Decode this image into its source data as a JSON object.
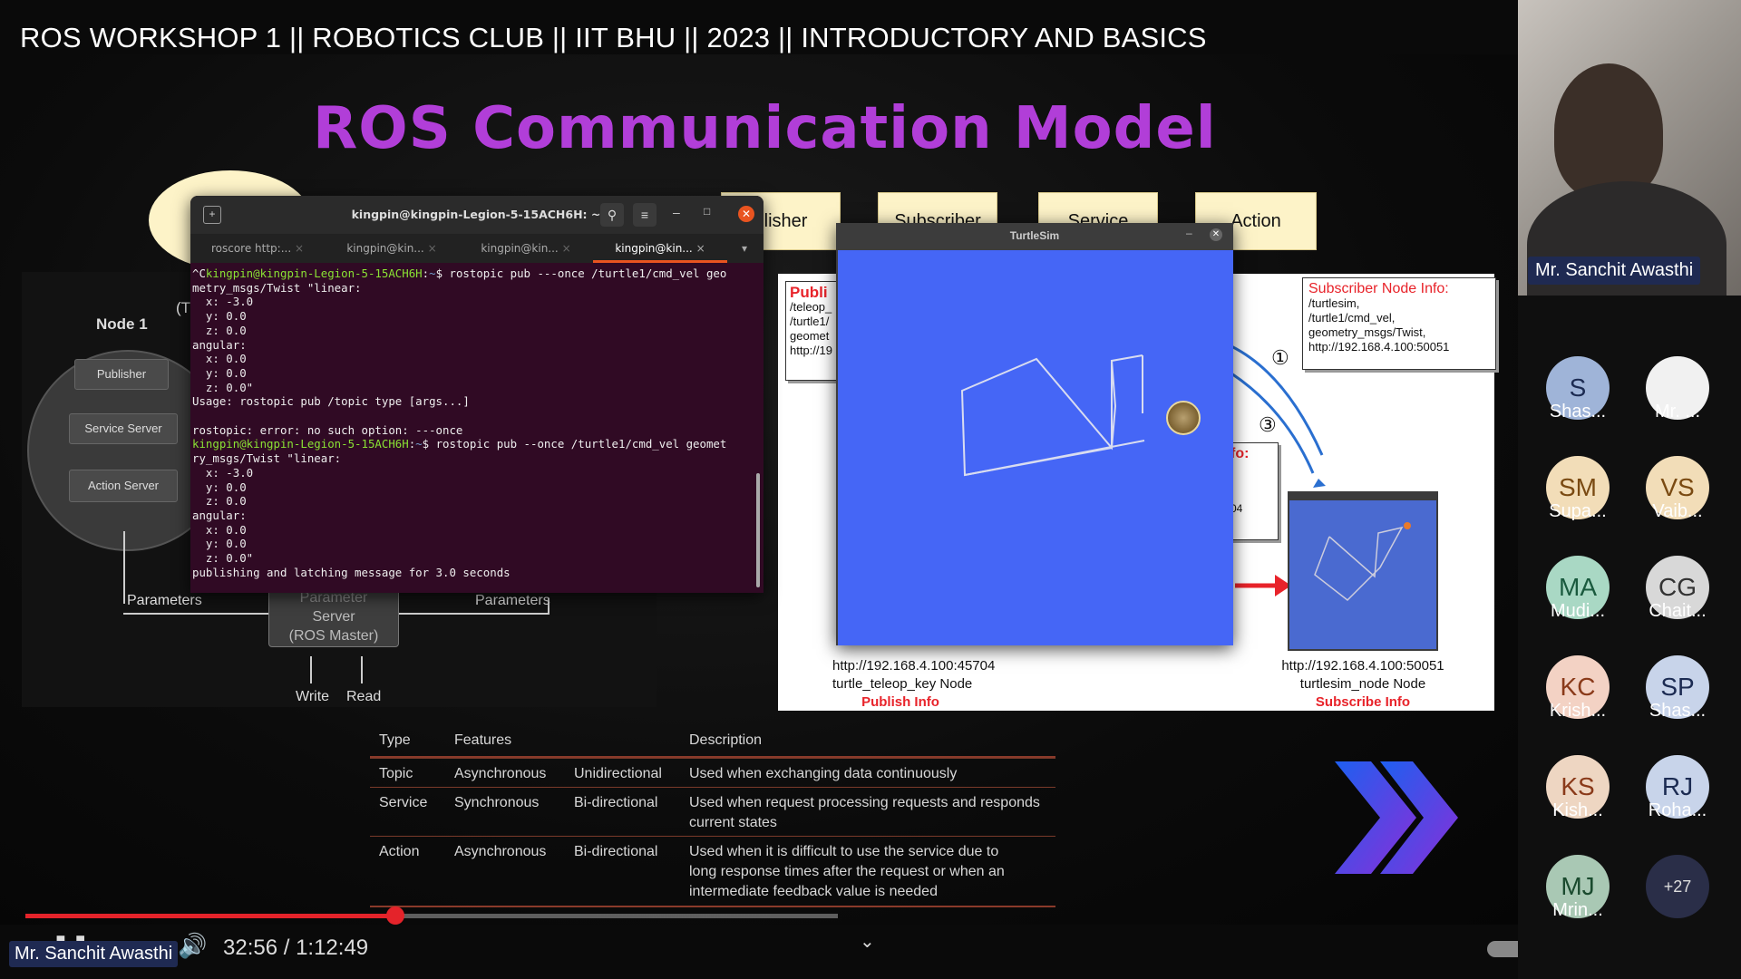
{
  "video": {
    "title": "ROS WORKSHOP 1 || ROBOTICS CLUB || IIT BHU || 2023 || INTRODUCTORY AND BASICS"
  },
  "slide": {
    "title": "ROS Communication Model",
    "top_boxes": [
      "blisher",
      "Subscriber",
      "Service",
      "Action"
    ],
    "node_diagram": {
      "node_label": "Node 1",
      "partial_label": "(T",
      "buttons": [
        "Publisher",
        "Service Server",
        "Action Server"
      ],
      "params_left": "Parameters",
      "params_right": "Parameters",
      "master_line1": "Parameter",
      "master_line2": "Server",
      "master_line3": "(ROS Master)",
      "write": "Write",
      "read": "Read"
    },
    "table": {
      "headers": [
        "Type",
        "Features",
        "",
        "Description"
      ],
      "rows": [
        {
          "type": "Topic",
          "sync": "Asynchronous",
          "dir": "Unidirectional",
          "desc": "Used when exchanging data continuously"
        },
        {
          "type": "Service",
          "sync": "Synchronous",
          "dir": "Bi-directional",
          "desc": "Used when request processing requests and responds current states"
        },
        {
          "type": "Action",
          "sync": "Asynchronous",
          "dir": "Bi-directional",
          "desc": "Used when it is difficult to use the service due to long response times after the request or when an intermediate feedback value is needed"
        }
      ]
    }
  },
  "terminal": {
    "title": "kingpin@kingpin-Legion-5-15ACH6H: ~",
    "tabs": [
      "roscore http:...",
      "kingpin@kin...",
      "kingpin@kin...",
      "kingpin@kin..."
    ],
    "prompt": "kingpin@kingpin-Legion-5-15ACH6H",
    "cmd1": "rostopic pub ---once /turtle1/cmd_vel geo",
    "cmd1_cont": "metry_msgs/Twist \"linear:",
    "out1": "  x: -3.0\n  y: 0.0\n  z: 0.0\nangular:\n  x: 0.0\n  y: 0.0\n  z: 0.0\"\nUsage: rostopic pub /topic type [args...]\n\nrostopic: error: no such option: ---once",
    "cmd2": "rostopic pub --once /turtle1/cmd_vel geomet",
    "cmd2_cont": "ry_msgs/Twist \"linear:",
    "out2": "  x: -3.0\n  y: 0.0\n  z: 0.0\nangular:\n  x: 0.0\n  y: 0.0\n  z: 0.0\"\npublishing and latching message for 3.0 seconds"
  },
  "turtlesim": {
    "title": "TurtleSim"
  },
  "diagram": {
    "publisher_partial": "Publi",
    "publisher_lines": [
      "/teleop_",
      "/turtle1/",
      "geomet",
      "http://19"
    ],
    "subscriber_title": "Subscriber Node Info:",
    "subscriber_lines": [
      "/turtlesim,",
      "/turtle1/cmd_vel,",
      "geometry_msgs/Twist,",
      "http://192.168.4.100:50051"
    ],
    "info_partial": "fo:",
    "num_partial": "04",
    "step1": "①",
    "step3": "③",
    "left_url": "http://192.168.4.100:45704",
    "left_node": "turtle_teleop_key Node",
    "left_info": "Publish Info",
    "right_url": "http://192.168.4.100:50051",
    "right_node": "turtlesim_node Node",
    "right_info": "Subscribe Info"
  },
  "participants": {
    "speaker_name": "Mr. Sanchit Awasthi",
    "list": [
      {
        "initials": "S",
        "name": "Shas...",
        "color": "#9fb4d8",
        "text": "#1c2b52"
      },
      {
        "initials": "",
        "name": "Mr. ...",
        "color": "#f1f1f1",
        "text": "#222"
      },
      {
        "initials": "SM",
        "name": "Supa...",
        "color": "#f2ddb8",
        "text": "#7a4a12"
      },
      {
        "initials": "VS",
        "name": "Vaib...",
        "color": "#f2ddb8",
        "text": "#7a4a12"
      },
      {
        "initials": "MA",
        "name": "Mudi...",
        "color": "#a9d8c4",
        "text": "#1a5a3e"
      },
      {
        "initials": "CG",
        "name": "Chait...",
        "color": "#d8d8d8",
        "text": "#333"
      },
      {
        "initials": "KC",
        "name": "Krish...",
        "color": "#f3d2c4",
        "text": "#8a3a1a"
      },
      {
        "initials": "SP",
        "name": "Shas...",
        "color": "#c8d4ea",
        "text": "#1c2b52"
      },
      {
        "initials": "KS",
        "name": "Kish...",
        "color": "#eed6c2",
        "text": "#8a3a1a"
      },
      {
        "initials": "RJ",
        "name": "Roha...",
        "color": "#c8d4ea",
        "text": "#1c2b52"
      },
      {
        "initials": "MJ",
        "name": "Mrin...",
        "color": "#a9c8b4",
        "text": "#1a4a2e"
      }
    ],
    "more": "+27"
  },
  "player": {
    "time": "32:56 / 1:12:49",
    "progress": 0.455,
    "bottom_name": "Mr. Sanchit Awasthi"
  },
  "colors": {
    "accent_red": "#e4232a",
    "slide_title": "#b13ed8",
    "terminal_bg": "#300a24",
    "turtle_bg": "#4566f6"
  }
}
